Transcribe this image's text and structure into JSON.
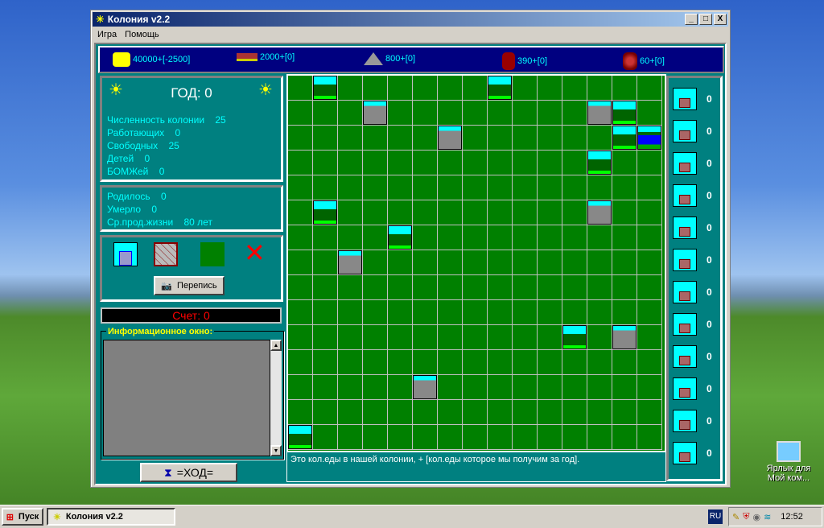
{
  "window": {
    "title": "Колония v2.2",
    "min": "_",
    "max": "□",
    "close": "X"
  },
  "menu": [
    "Игра",
    "Помощь"
  ],
  "resources": [
    {
      "icon": "food-icon",
      "text": "40000+[-2500]"
    },
    {
      "icon": "wood-icon",
      "text": "2000+[0]"
    },
    {
      "icon": "stone-icon",
      "text": "800+[0]"
    },
    {
      "icon": "leather-icon",
      "text": "390+[0]"
    },
    {
      "icon": "ore-icon",
      "text": "60+[0]"
    }
  ],
  "stats": {
    "year": "ГОД: 0",
    "rows": [
      "Численность колонии    25",
      "Работающих    0",
      "Свободных    25",
      "Детей    0",
      "БОМЖей    0"
    ],
    "rows2": [
      "Родилось    0",
      "Умерло    0",
      "Ср.прод.жизни    80 лет"
    ]
  },
  "census_button": "Перепись",
  "score": "Счет: 0",
  "info_title": "Информационное окно:",
  "turn_button": "=ХОД=",
  "status": "Это кол.еды в нашей колонии, + [кол.еды которое мы получим за год].",
  "colors": {
    "grass": "#008000",
    "teal": "#008080",
    "navy": "#000080"
  },
  "tiles": [
    {
      "c": 1,
      "r": 0,
      "t": "forest"
    },
    {
      "c": 8,
      "r": 0,
      "t": "forest"
    },
    {
      "c": 3,
      "r": 1,
      "t": "mountain"
    },
    {
      "c": 12,
      "r": 1,
      "t": "mountain"
    },
    {
      "c": 13,
      "r": 1,
      "t": "forest"
    },
    {
      "c": 6,
      "r": 2,
      "t": "mountain"
    },
    {
      "c": 13,
      "r": 2,
      "t": "forest"
    },
    {
      "c": 14,
      "r": 2,
      "t": "lake"
    },
    {
      "c": 12,
      "r": 3,
      "t": "forest"
    },
    {
      "c": 1,
      "r": 5,
      "t": "forest"
    },
    {
      "c": 12,
      "r": 5,
      "t": "mountain"
    },
    {
      "c": 4,
      "r": 6,
      "t": "forest"
    },
    {
      "c": 2,
      "r": 7,
      "t": "mountain"
    },
    {
      "c": 11,
      "r": 10,
      "t": "forest"
    },
    {
      "c": 13,
      "r": 10,
      "t": "mountain"
    },
    {
      "c": 5,
      "r": 12,
      "t": "mountain"
    },
    {
      "c": 0,
      "r": 14,
      "t": "forest"
    }
  ],
  "buildings": [
    {
      "icon": "house-icon",
      "count": "0"
    },
    {
      "icon": "field-icon",
      "count": "0"
    },
    {
      "icon": "hut-icon",
      "count": "0"
    },
    {
      "icon": "sawmill-icon",
      "count": "0"
    },
    {
      "icon": "quarry-icon",
      "count": "0"
    },
    {
      "icon": "farm-icon",
      "count": "0"
    },
    {
      "icon": "school-icon",
      "count": "0"
    },
    {
      "icon": "cottage-icon",
      "count": "0"
    },
    {
      "icon": "hospital-icon",
      "count": "0"
    },
    {
      "icon": "mine-icon",
      "count": "0"
    },
    {
      "icon": "orchard-icon",
      "count": "0"
    },
    {
      "icon": "mansion-icon",
      "count": "0"
    }
  ],
  "taskbar": {
    "start": "Пуск",
    "task": "Колония v2.2",
    "lang": "RU",
    "clock": "12:52"
  },
  "desktop_icon": {
    "line1": "Ярлык для",
    "line2": "Мой ком..."
  }
}
